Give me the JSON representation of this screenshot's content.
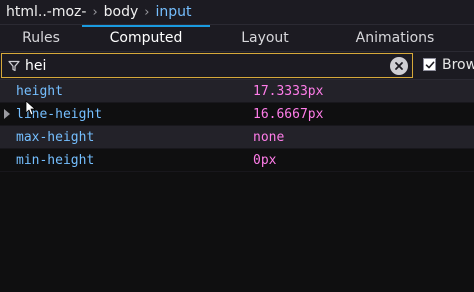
{
  "breadcrumb": {
    "items": [
      "html..-moz-",
      "body",
      "input"
    ],
    "separator": "›"
  },
  "tabs": [
    {
      "label": "Rules",
      "active": false
    },
    {
      "label": "Computed",
      "active": true
    },
    {
      "label": "Layout",
      "active": false
    },
    {
      "label": "Animations",
      "active": false
    }
  ],
  "filter": {
    "value": "hei",
    "icon": "filter-icon",
    "clear_icon": "clear-icon"
  },
  "browser_styles": {
    "label": "Brow",
    "checked": true
  },
  "properties": [
    {
      "name": "height",
      "value": "17.3333px",
      "expandable": false
    },
    {
      "name": "line-height",
      "value": "16.6667px",
      "expandable": true
    },
    {
      "name": "max-height",
      "value": "none",
      "expandable": false
    },
    {
      "name": "min-height",
      "value": "0px",
      "expandable": false
    }
  ],
  "colors": {
    "accent": "#1a9be0",
    "filter_border": "#d6a93a",
    "prop_name": "#75bfff",
    "prop_value": "#ff7de9",
    "current_crumb": "#75bfff"
  }
}
